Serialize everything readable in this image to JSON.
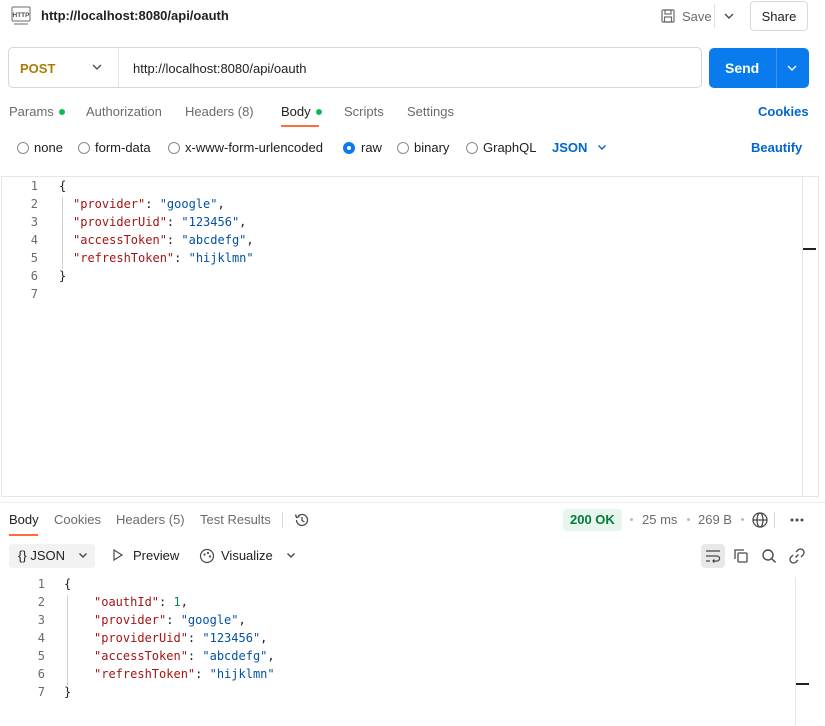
{
  "header": {
    "tab_title": "http://localhost:8080/api/oauth",
    "save_label": "Save",
    "share_label": "Share"
  },
  "request": {
    "method": "POST",
    "url": "http://localhost:8080/api/oauth",
    "send_label": "Send",
    "tabs": {
      "params": "Params",
      "authorization": "Authorization",
      "headers": "Headers (8)",
      "body": "Body",
      "scripts": "Scripts",
      "settings": "Settings"
    },
    "cookies_label": "Cookies",
    "body_options": {
      "none": "none",
      "form_data": "form-data",
      "urlencoded": "x-www-form-urlencoded",
      "raw": "raw",
      "binary": "binary",
      "graphql": "GraphQL",
      "selected": "raw"
    },
    "format": "JSON",
    "beautify_label": "Beautify",
    "line_numbers": [
      "1",
      "2",
      "3",
      "4",
      "5",
      "6",
      "7"
    ],
    "body_lines": [
      {
        "key": "\"provider\"",
        "value": "\"google\"",
        "trail": ","
      },
      {
        "key": "\"providerUid\"",
        "value": "\"123456\"",
        "trail": ","
      },
      {
        "key": "\"accessToken\"",
        "value": "\"abcdefg\"",
        "trail": ","
      },
      {
        "key": "\"refreshToken\"",
        "value": "\"hijklmn\"",
        "trail": ""
      }
    ]
  },
  "response": {
    "tabs": {
      "body": "Body",
      "cookies": "Cookies",
      "headers": "Headers (5)",
      "test_results": "Test Results"
    },
    "status": "200 OK",
    "time": "25 ms",
    "size": "269 B",
    "format": "JSON",
    "format_prefix": "{}",
    "preview_label": "Preview",
    "visualize_label": "Visualize",
    "line_numbers": [
      "1",
      "2",
      "3",
      "4",
      "5",
      "6",
      "7"
    ],
    "body_lines": [
      {
        "key": "\"oauthId\"",
        "value": "1",
        "trail": ",",
        "number": true
      },
      {
        "key": "\"provider\"",
        "value": "\"google\"",
        "trail": ","
      },
      {
        "key": "\"providerUid\"",
        "value": "\"123456\"",
        "trail": ","
      },
      {
        "key": "\"accessToken\"",
        "value": "\"abcdefg\"",
        "trail": ","
      },
      {
        "key": "\"refreshToken\"",
        "value": "\"hijklmn\"",
        "trail": ""
      }
    ]
  },
  "colors": {
    "accent": "#097bed",
    "method_post": "#ad7a03",
    "active_tab_underline": "#ff6c37",
    "status_ok_bg": "#e7f6ec",
    "status_ok_text": "#067a3a",
    "params_dot": "#0cbb52"
  }
}
